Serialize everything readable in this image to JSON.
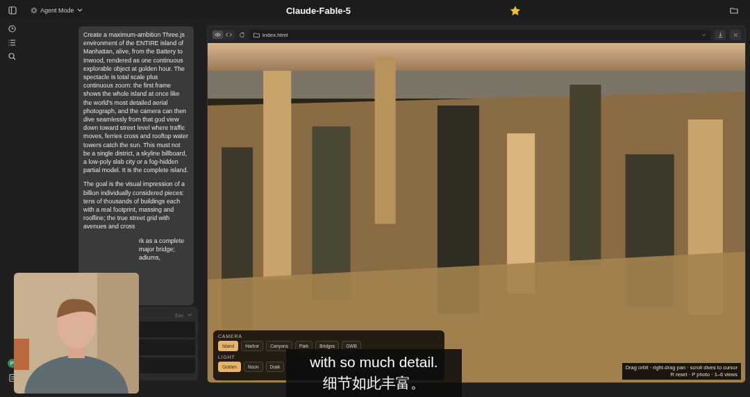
{
  "topbar": {
    "agent_mode": "Agent Mode",
    "title": "Claude-Fable-5",
    "starred": true
  },
  "prompt": {
    "paragraphs": [
      "Create a maximum-ambition Three.js environment of the ENTIRE island of Manhattan, alive, from the Battery to Inwood, rendered as one continuous explorable object at golden hour. The spectacle is total scale plus continuous zoom: the first frame shows the whole island at once like the world's most detailed aerial photograph, and the camera can then dive seamlessly from that god view down toward street level where traffic moves, ferries cross and rooftop water towers catch the sun. This must not be a single district, a skyline billboard, a low-poly slab city or a fog-hidden partial model. It is the complete island.",
      "The goal is the visual impression of a billion individually considered pieces: tens of thousands of buildings each with a real footprint, massing and roofline; the true street grid with avenues and cross"
    ],
    "fragments": [
      "rk as a complete",
      "major bridge;",
      "adiums,"
    ]
  },
  "side_panel": {
    "shortcut": "Esc"
  },
  "avatar": {
    "initial": "P"
  },
  "preview": {
    "view_modes": [
      {
        "kind": "preview",
        "selected": true
      },
      {
        "kind": "code",
        "selected": false
      }
    ],
    "url": "index.html"
  },
  "overlay": {
    "groups": [
      {
        "label": "CAMERA",
        "options": [
          {
            "label": "Island",
            "selected": true
          },
          {
            "label": "Harbor",
            "selected": false
          },
          {
            "label": "Canyons",
            "selected": false
          },
          {
            "label": "Park",
            "selected": false
          },
          {
            "label": "Bridges",
            "selected": false
          },
          {
            "label": "GWB",
            "selected": false
          }
        ]
      },
      {
        "label": "LIGHT",
        "options": [
          {
            "label": "Golden",
            "selected": true
          },
          {
            "label": "Noon",
            "selected": false
          },
          {
            "label": "Dusk",
            "selected": false
          }
        ]
      }
    ]
  },
  "hint": {
    "lines": [
      "Drag orbit · right-drag pan · scroll dives to cursor",
      "R reset · P photo · 1–6 views"
    ]
  },
  "webcam": {
    "kind": "picture"
  },
  "subtitles": [
    "with so much detail.",
    "细节如此丰富。"
  ]
}
